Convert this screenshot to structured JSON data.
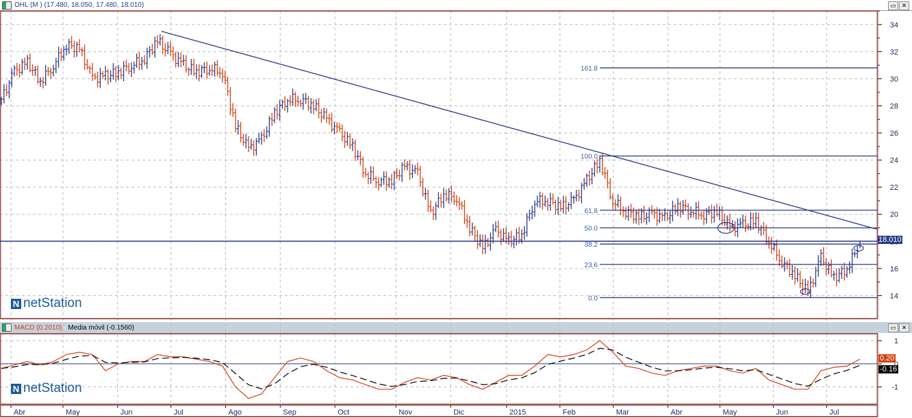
{
  "top_panel": {
    "title": "OHL (M ) (17.480, 18.050, 17.480, 18.010)",
    "last_price_label": "18.010",
    "logo": "netStation",
    "buttons": {
      "maximize": "▭",
      "close": "✕"
    }
  },
  "bottom_panel": {
    "macd_label": "MACD (0.2010)",
    "separator": " - ",
    "signal_label": "Media móvil (-0.1560)",
    "macd_value_label": "0.20",
    "signal_value_label": "-0.16",
    "logo": "netStation",
    "buttons": {
      "maximize": "▭",
      "close": "✕"
    }
  },
  "colors": {
    "up": "#2b3a8a",
    "down": "#d04010",
    "frame": "#a05a5a",
    "line": "#2b3a8a",
    "macd": "#d04010",
    "signal": "#000000"
  },
  "chart_data": [
    {
      "type": "ohlc",
      "title": "OHL (M )",
      "x_unit": "week index",
      "y_ticks": [
        14,
        16,
        18,
        20,
        22,
        24,
        26,
        28,
        30,
        32,
        34
      ],
      "ylim": [
        12.3,
        35
      ],
      "x_tick_labels": [
        "Abr",
        "May",
        "Jun",
        "Jul",
        "Ago",
        "Sep",
        "Oct",
        "Nov",
        "Dic",
        "2015",
        "Feb",
        "Mar",
        "Abr",
        "May",
        "Jun",
        "Jul"
      ],
      "x_tick_weeks": [
        1,
        5,
        9.2,
        13.3,
        17.5,
        21.7,
        25.9,
        30.6,
        34.8,
        39.1,
        43.2,
        47.3,
        51.5,
        55.5,
        59.6,
        63.7
      ],
      "weekly_close": [
        28.5,
        30.5,
        31.2,
        29.8,
        31,
        32.5,
        32.2,
        30,
        30.2,
        30.5,
        31,
        31.5,
        32.8,
        31.8,
        31,
        30.5,
        30.8,
        30.5,
        26.5,
        24.8,
        25.5,
        27.5,
        28.5,
        28.5,
        28,
        27,
        26,
        25,
        23,
        22.5,
        22.5,
        23.5,
        23,
        20,
        21.5,
        21.2,
        19,
        17.5,
        18.8,
        18,
        18.5,
        21,
        21,
        20.5,
        21,
        22.5,
        24,
        21,
        20.2,
        19.8,
        20,
        19.7,
        20.6,
        20.3,
        20,
        20.2,
        19,
        19.2,
        19.5,
        18,
        16.5,
        15.5,
        14.2,
        16.8,
        15.3,
        16,
        17.9
      ],
      "last": {
        "open": 17.48,
        "high": 18.05,
        "low": 17.48,
        "close": 18.01
      },
      "trendline": {
        "from": [
          12.3,
          33.5
        ],
        "to": [
          67.3,
          18.9
        ]
      },
      "price_line": 18.01,
      "fibonacci": {
        "start_week": 46,
        "levels": [
          {
            "label": "161.8",
            "value": 30.8
          },
          {
            "label": "100.0",
            "value": 24.3
          },
          {
            "label": "61.8",
            "value": 20.3
          },
          {
            "label": "50.0",
            "value": 19.0
          },
          {
            "label": "38.2",
            "value": 17.8
          },
          {
            "label": "23.6",
            "value": 16.3
          },
          {
            "label": "0.0",
            "value": 13.85
          }
        ]
      },
      "markers": [
        [
          55.7,
          19.0
        ],
        [
          61.8,
          14.3
        ],
        [
          65.9,
          17.5
        ]
      ]
    },
    {
      "type": "line",
      "title": "MACD",
      "y_ticks": [
        1,
        0,
        -1
      ],
      "ylim": [
        -1.75,
        1.3
      ],
      "series": [
        {
          "name": "MACD",
          "values": [
            -0.2,
            -0.05,
            0.1,
            -0.05,
            0.1,
            0.4,
            0.5,
            0.4,
            -0.3,
            0,
            0.1,
            0.1,
            0.4,
            0.3,
            0.3,
            0.2,
            0.1,
            -0.1,
            -1.0,
            -1.5,
            -1.3,
            -0.6,
            0.1,
            0.25,
            0.1,
            -0.3,
            -0.6,
            -0.7,
            -0.9,
            -1.1,
            -1.1,
            -0.8,
            -0.6,
            -0.7,
            -0.5,
            -0.6,
            -0.9,
            -1.1,
            -0.8,
            -0.5,
            -0.5,
            -0.1,
            0.4,
            0.3,
            0.4,
            0.6,
            1.0,
            0.5,
            -0.1,
            -0.2,
            -0.4,
            -0.5,
            -0.3,
            -0.2,
            -0.1,
            -0.1,
            -0.3,
            -0.4,
            -0.2,
            -0.7,
            -0.9,
            -1.1,
            -1.1,
            -0.3,
            -0.15,
            -0.1,
            0.2
          ]
        },
        {
          "name": "Media móvil",
          "smoothing": 0.45
        }
      ]
    }
  ]
}
